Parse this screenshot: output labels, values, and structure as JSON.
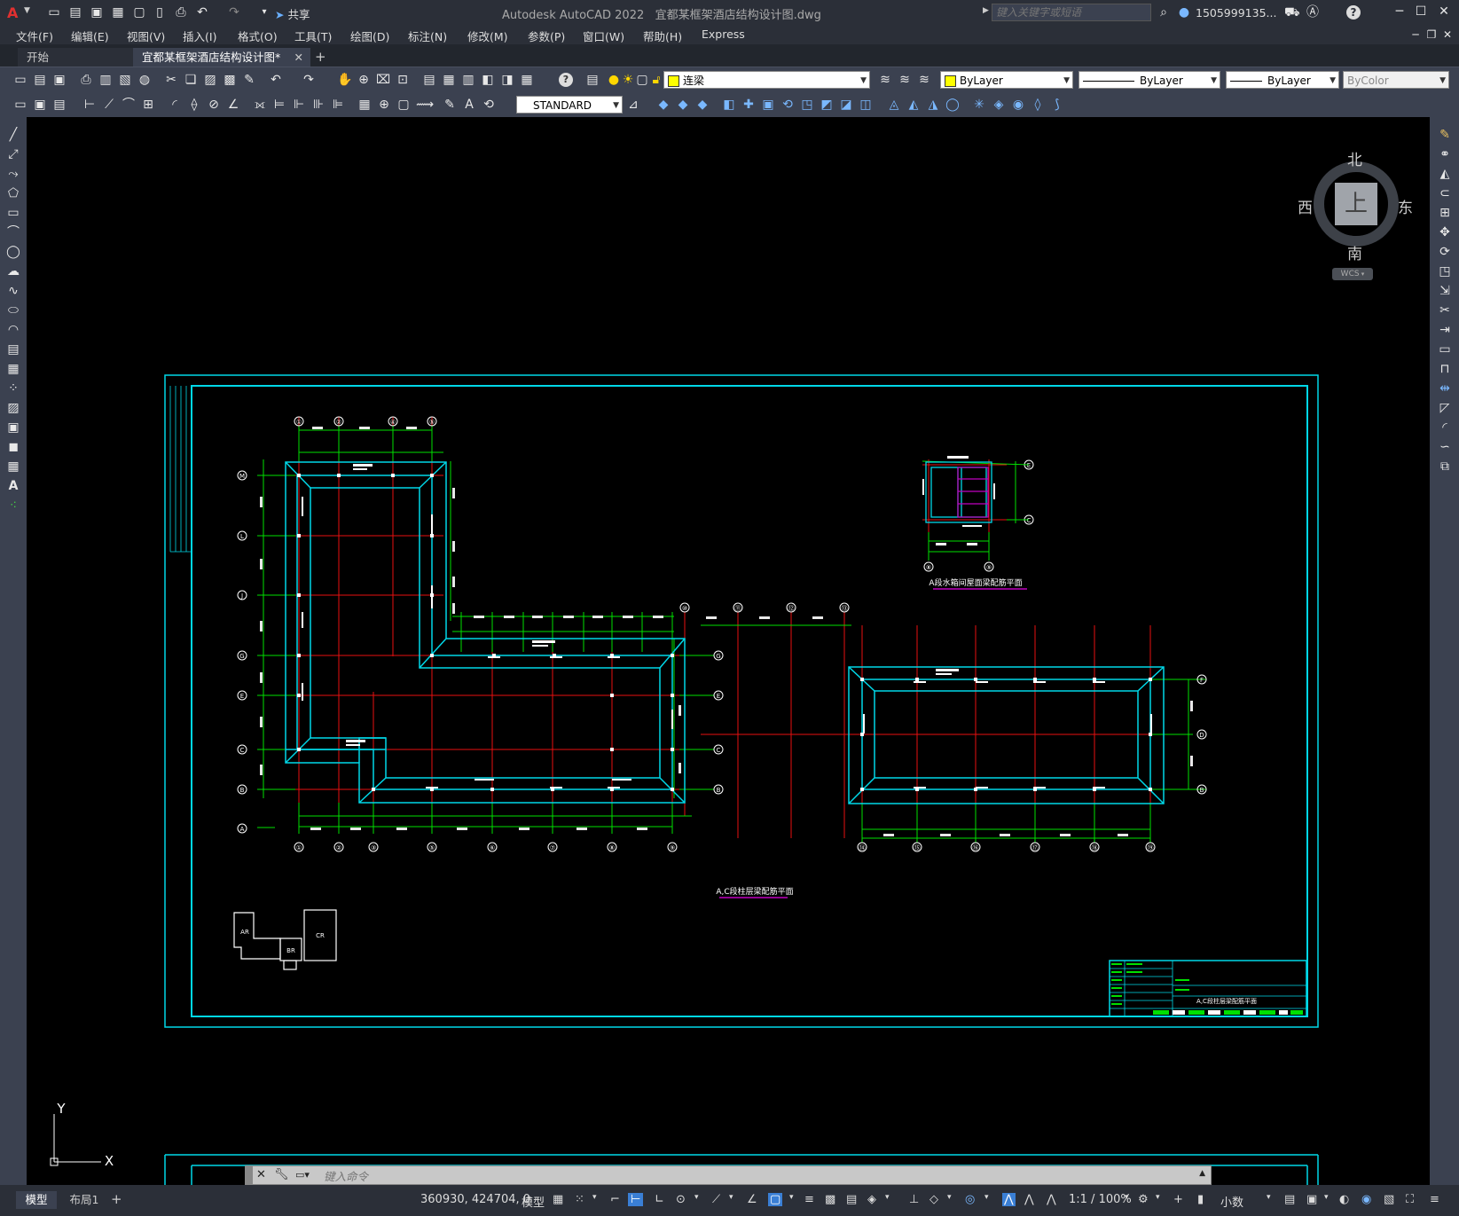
{
  "app": {
    "title": "Autodesk AutoCAD 2022",
    "file_title": "宜都某框架酒店结构设计图.dwg",
    "share_label": "共享",
    "search_placeholder": "键入关键字或短语",
    "user": "1505999135..."
  },
  "menu": [
    "文件(F)",
    "编辑(E)",
    "视图(V)",
    "插入(I)",
    "格式(O)",
    "工具(T)",
    "绘图(D)",
    "标注(N)",
    "修改(M)",
    "参数(P)",
    "窗口(W)",
    "帮助(H)",
    "Express"
  ],
  "tabs": {
    "start": "开始",
    "doc": "宜都某框架酒店结构设计图*"
  },
  "toolbar": {
    "layer": "连梁",
    "color": "ByLayer",
    "linetype": "ByLayer",
    "lineweight": "ByLayer",
    "plotstyle": "ByColor",
    "textstyle": "STANDARD"
  },
  "viewcube": {
    "north": "北",
    "south": "南",
    "east": "东",
    "west": "西",
    "top": "上",
    "wcs": "WCS"
  },
  "ucs": {
    "y": "Y",
    "x": "X"
  },
  "command": {
    "placeholder": "键入命令"
  },
  "drawing": {
    "main_title": "A,C段柱层梁配筋平面",
    "small_title": "A段水箱间屋面梁配筋平面",
    "key_plan": [
      "AR",
      "BR",
      "CR"
    ],
    "grid_top": [
      "①",
      "②",
      "④",
      "⑤",
      "⑩",
      "⑪",
      "⑫",
      "⑬"
    ],
    "grid_bottom": [
      "①",
      "②",
      "③",
      "⑤",
      "⑥",
      "⑦",
      "⑧",
      "⑨",
      "⑭",
      "⑮",
      "⑯",
      "⑰",
      "⑱",
      "⑲"
    ],
    "grid_left": [
      "M",
      "L",
      "J",
      "G",
      "E",
      "C",
      "B",
      "A"
    ],
    "grid_right_mid": [
      "G",
      "E",
      "C",
      "B"
    ],
    "grid_right_far": [
      "F",
      "D",
      "B"
    ],
    "grid_small_right": [
      "E",
      "C"
    ],
    "grid_small_bottom": [
      "⑧",
      "⑨"
    ],
    "titleblock_caption": "A,C段柱层梁配筋平面"
  },
  "status": {
    "layout_tabs": [
      "模型",
      "布局1"
    ],
    "coords": "360930, 424704, 0",
    "model": "模型",
    "scale": "1:1 / 100%",
    "units": "小数"
  }
}
